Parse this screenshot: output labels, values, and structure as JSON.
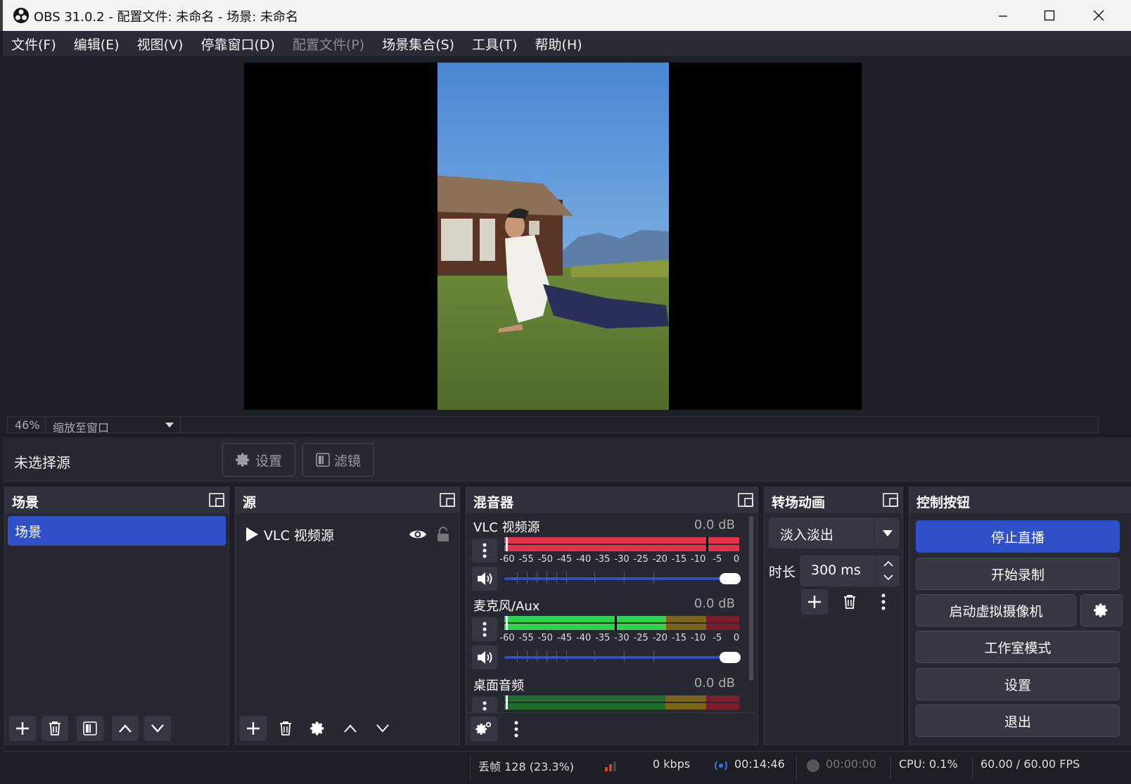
{
  "window": {
    "title": "OBS 31.0.2 - 配置文件: 未命名 - 场景: 未命名"
  },
  "menu": [
    {
      "label": "文件(F)",
      "disabled": false
    },
    {
      "label": "编辑(E)",
      "disabled": false
    },
    {
      "label": "视图(V)",
      "disabled": false
    },
    {
      "label": "停靠窗口(D)",
      "disabled": false
    },
    {
      "label": "配置文件(P)",
      "disabled": true
    },
    {
      "label": "场景集合(S)",
      "disabled": false
    },
    {
      "label": "工具(T)",
      "disabled": false
    },
    {
      "label": "帮助(H)",
      "disabled": false
    }
  ],
  "zoom": {
    "percent": "46%",
    "label": "缩放至窗口"
  },
  "source_bar": {
    "no_selection": "未选择源",
    "settings": "设置",
    "filters": "滤镜"
  },
  "scenes": {
    "title": "场景",
    "items": [
      "场景"
    ]
  },
  "sources": {
    "title": "源",
    "items": [
      {
        "name": "VLC 视频源"
      }
    ]
  },
  "mixer": {
    "title": "混音器",
    "ticks": [
      "-60",
      "-55",
      "-50",
      "-45",
      "-40",
      "-35",
      "-30",
      "-25",
      "-20",
      "-15",
      "-10",
      "-5",
      "0"
    ],
    "channels": [
      {
        "name": "VLC 视频源",
        "db": "0.0 dB",
        "level": 1.0,
        "peak": 0.86,
        "muted": true,
        "volume": 1.0
      },
      {
        "name": "麦克风/Aux",
        "db": "0.0 dB",
        "level": 0.69,
        "peak": 0.47,
        "muted": false,
        "volume": 1.0
      },
      {
        "name": "桌面音频",
        "db": "0.0 dB",
        "level": 0.0,
        "peak": 0.0,
        "muted": false,
        "volume": 1.0
      }
    ]
  },
  "transitions": {
    "title": "转场动画",
    "selected": "淡入淡出",
    "duration_label": "时长",
    "duration": "300 ms"
  },
  "controls": {
    "title": "控制按钮",
    "stop_stream": "停止直播",
    "start_record": "开始录制",
    "virtual_cam": "启动虚拟摄像机",
    "studio_mode": "工作室模式",
    "settings": "设置",
    "exit": "退出"
  },
  "status": {
    "dropped": "丢帧 128 (23.3%)",
    "bitrate": "0 kbps",
    "stream_time": "00:14:46",
    "record_time": "00:00:00",
    "cpu": "CPU: 0.1%",
    "fps": "60.00 / 60.00 FPS"
  },
  "colors": {
    "accent": "#2f50c8",
    "meter_green": "#2ed24d",
    "meter_yellow": "#c99b1f",
    "meter_red": "#e5334b"
  }
}
